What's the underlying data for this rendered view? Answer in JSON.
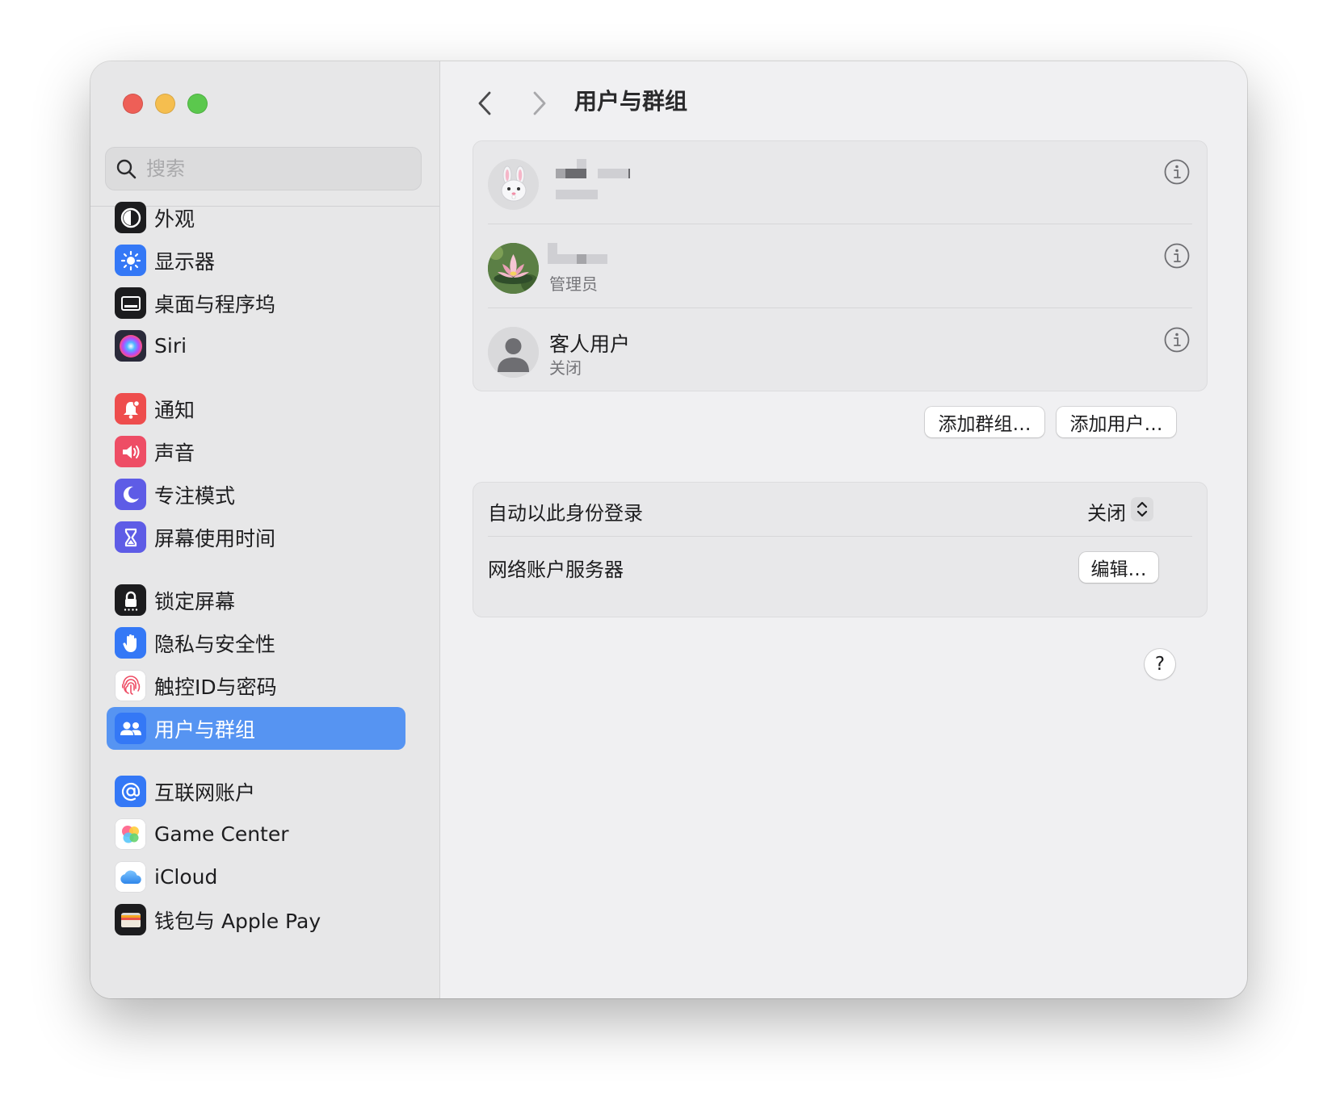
{
  "window": {
    "title": "用户与群组"
  },
  "search": {
    "placeholder": "搜索"
  },
  "sidebar": {
    "items": [
      {
        "label": "外观",
        "icon": "appearance-icon",
        "color": "#1c1c1e"
      },
      {
        "label": "显示器",
        "icon": "display-brightness-icon",
        "color": "#3478f6"
      },
      {
        "label": "桌面与程序坞",
        "icon": "desktop-dock-icon",
        "color": "#1c1c1e"
      },
      {
        "label": "Siri",
        "icon": "siri-icon",
        "color": "#2a2a3a"
      },
      {
        "label": "通知",
        "icon": "notification-bell-icon",
        "color": "#ee4d4d"
      },
      {
        "label": "声音",
        "icon": "speaker-icon",
        "color": "#ee4d65"
      },
      {
        "label": "专注模式",
        "icon": "moon-icon",
        "color": "#5e5ce6"
      },
      {
        "label": "屏幕使用时间",
        "icon": "hourglass-icon",
        "color": "#5e5ce6"
      },
      {
        "label": "锁定屏幕",
        "icon": "lock-icon",
        "color": "#1c1c1e"
      },
      {
        "label": "隐私与安全性",
        "icon": "hand-icon",
        "color": "#3478f6"
      },
      {
        "label": "触控ID与密码",
        "icon": "fingerprint-icon",
        "color": "#ffffff"
      },
      {
        "label": "用户与群组",
        "icon": "users-icon",
        "color": "#3478f6",
        "selected": true
      },
      {
        "label": "互联网账户",
        "icon": "at-sign-icon",
        "color": "#3478f6"
      },
      {
        "label": "Game Center",
        "icon": "game-center-icon",
        "color": "#ffffff"
      },
      {
        "label": "iCloud",
        "icon": "icloud-icon",
        "color": "#ffffff"
      },
      {
        "label": "钱包与 Apple Pay",
        "icon": "wallet-icon",
        "color": "#1c1c1e"
      }
    ]
  },
  "users": [
    {
      "name": "",
      "role": "",
      "avatar": "bunny-avatar-icon"
    },
    {
      "name": "",
      "role": "管理员",
      "avatar": "lotus-avatar-icon"
    },
    {
      "name": "客人用户",
      "role": "关闭",
      "avatar": "person-silhouette-icon"
    }
  ],
  "buttons": {
    "add_group": "添加群组…",
    "add_user": "添加用户…",
    "edit": "编辑…",
    "help": "?"
  },
  "options": {
    "auto_login_label": "自动以此身份登录",
    "auto_login_value": "关闭",
    "network_server_label": "网络账户服务器"
  },
  "colors": {
    "accent": "#5694f2",
    "sidebar_bg": "#e7e7e8",
    "content_bg": "#f0f0f2"
  }
}
